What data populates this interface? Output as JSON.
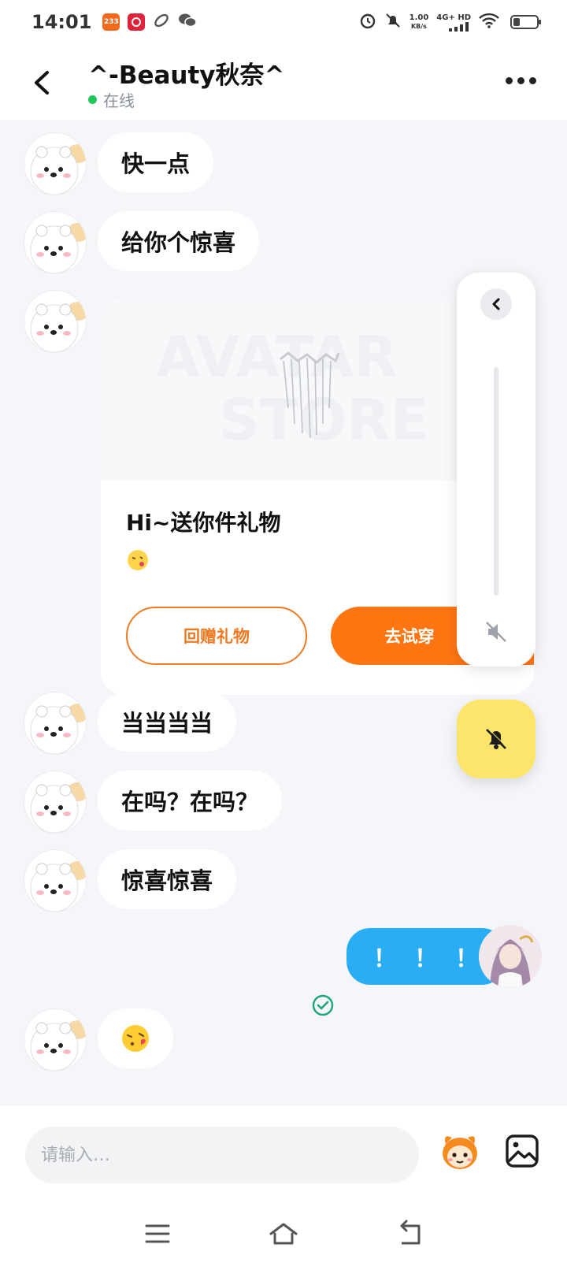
{
  "status_bar": {
    "time": "14:01",
    "app_badges": [
      {
        "icon": "app-233-icon",
        "text": "233",
        "color": "#f26a1b"
      },
      {
        "icon": "app-red-icon",
        "text": "",
        "color": "#e0223a"
      },
      {
        "icon": "app-link-icon",
        "text": "",
        "color": "#555555"
      },
      {
        "icon": "wechat-icon",
        "text": "",
        "color": "#555555"
      }
    ],
    "net_speed_value": "1.00",
    "net_speed_unit": "KB/s",
    "net_type": "4G+ HD",
    "battery_level": 0.3
  },
  "header": {
    "title": "^-Beauty秋奈^",
    "status": "在线",
    "status_color": "#22c55e"
  },
  "messages": [
    {
      "from": "other",
      "type": "text",
      "text": "快一点"
    },
    {
      "from": "other",
      "type": "text",
      "text": "给你个惊喜"
    },
    {
      "from": "other",
      "type": "gift"
    },
    {
      "from": "other",
      "type": "text",
      "text": "当当当当"
    },
    {
      "from": "other",
      "type": "text",
      "text": "在吗？在吗？"
    },
    {
      "from": "other",
      "type": "text",
      "text": "惊喜惊喜"
    },
    {
      "from": "me",
      "type": "text",
      "text": "！！！",
      "read": true
    },
    {
      "from": "other",
      "type": "emoji",
      "text": "😘"
    }
  ],
  "gift_card": {
    "title": "Hi~送你件礼物",
    "emoji": "😘",
    "return_gift_label": "回赠礼物",
    "try_on_label": "去试穿",
    "accent_color": "#ff7512"
  },
  "side_panel": {
    "collapse_icon": "chevron-left-icon",
    "mute_icon": "speaker-muted-icon",
    "bell_icon": "bell-muted-icon",
    "bell_bg": "#fde46a"
  },
  "input_bar": {
    "placeholder": "请输入…",
    "mascot_icon": "mascot-icon",
    "image_icon": "image-icon"
  },
  "nav_bar": {
    "items": [
      "menu-icon",
      "home-icon",
      "back-icon"
    ]
  }
}
